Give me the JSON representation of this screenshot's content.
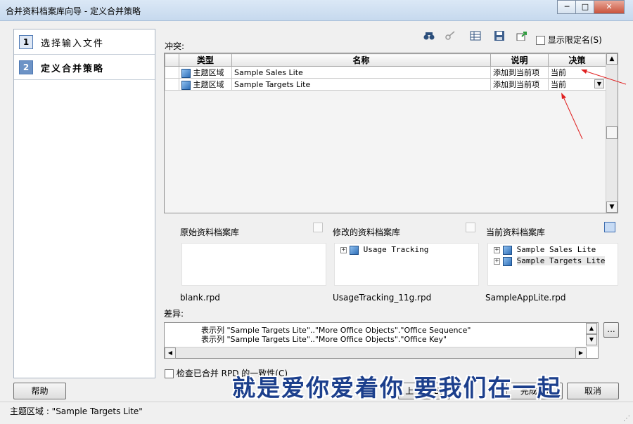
{
  "window": {
    "title": "合并资料档案库向导 - 定义合并策略",
    "minimize": "─",
    "maximize": "□",
    "close": "✕"
  },
  "steps": [
    {
      "num": "1",
      "label": "选择输入文件"
    },
    {
      "num": "2",
      "label": "定义合并策略"
    }
  ],
  "conflicts": {
    "label": "冲突:",
    "show_qualified": "显示限定名(S)",
    "columns": {
      "type": "类型",
      "name": "名称",
      "desc": "说明",
      "decision": "决策"
    },
    "rows": [
      {
        "type": "主题区域",
        "name": "Sample Sales Lite",
        "desc": "添加到当前项",
        "decision": "当前"
      },
      {
        "type": "主题区域",
        "name": "Sample Targets Lite",
        "desc": "添加到当前项",
        "decision": "当前"
      }
    ]
  },
  "repos": {
    "original": {
      "title": "原始资料档案库",
      "file": "blank.rpd",
      "items": []
    },
    "modified": {
      "title": "修改的资料档案库",
      "file": "UsageTracking_11g.rpd",
      "items": [
        "Usage Tracking"
      ]
    },
    "current": {
      "title": "当前资料档案库",
      "file": "SampleAppLite.rpd",
      "items": [
        "Sample Sales Lite",
        "Sample Targets Lite"
      ]
    }
  },
  "diff": {
    "label": "差异:",
    "lines": [
      "表示列 \"Sample Targets Lite\"..\"More Office Objects\".\"Office Sequence\"",
      "表示列 \"Sample Targets Lite\"..\"More Office Objects\".\"Office Key\""
    ],
    "more_button": "..."
  },
  "check_consistency": "检查已合并 RPD 的一致性(C)",
  "buttons": {
    "help": "帮助",
    "back": "上一步(B)",
    "finish": "完成(F)",
    "cancel": "取消"
  },
  "status": "主题区域 : \"Sample Targets Lite\"",
  "subtitle_overlay": "就是爱你爱着你 要我们在一起"
}
